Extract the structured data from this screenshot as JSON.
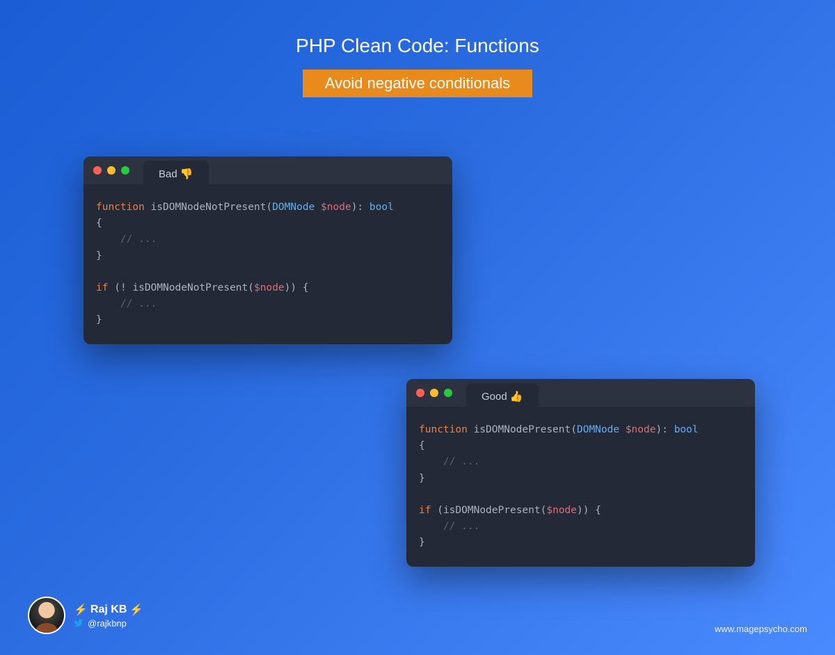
{
  "header": {
    "title": "PHP Clean Code: Functions",
    "subtitle": "Avoid negative conditionals"
  },
  "windows": {
    "bad": {
      "tab_label": "Bad 👎",
      "code": {
        "kw_function": "function",
        "fn_name": " isDOMNodeNotPresent",
        "open_paren": "(",
        "param_type": "DOMNode",
        "param_name": " $node",
        "close_paren": ")",
        "colon_return": ": ",
        "return_type": "bool",
        "brace_open": "{",
        "comment_body": "    // ...",
        "brace_close": "}",
        "blank": "",
        "kw_if": "if",
        "if_open": " (",
        "not_op": "! ",
        "call_fn": "isDOMNodeNotPresent",
        "call_open": "(",
        "call_arg": "$node",
        "call_close": ")",
        "if_close": ") ",
        "if_brace_open": "{",
        "if_comment": "    // ...",
        "if_brace_close": "}"
      }
    },
    "good": {
      "tab_label": "Good 👍",
      "code": {
        "kw_function": "function",
        "fn_name": " isDOMNodePresent",
        "open_paren": "(",
        "param_type": "DOMNode",
        "param_name": " $node",
        "close_paren": ")",
        "colon_return": ": ",
        "return_type": "bool",
        "brace_open": "{",
        "comment_body": "    // ...",
        "brace_close": "}",
        "blank": "",
        "kw_if": "if",
        "if_open": " (",
        "call_fn": "isDOMNodePresent",
        "call_open": "(",
        "call_arg": "$node",
        "call_close": ")",
        "if_close": ") ",
        "if_brace_open": "{",
        "if_comment": "    // ...",
        "if_brace_close": "}"
      }
    }
  },
  "footer": {
    "author_name": "Raj KB",
    "lightning": "⚡",
    "author_handle": "@rajkbnp",
    "website": "www.magepsycho.com"
  }
}
